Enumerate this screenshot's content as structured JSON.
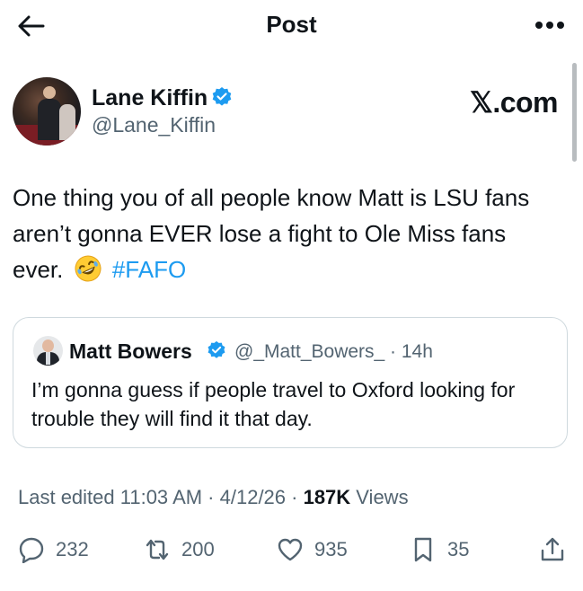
{
  "header": {
    "title": "Post",
    "back_icon": "arrow-left-icon",
    "more_icon": "more-horizontal-icon"
  },
  "author": {
    "name": "Lane Kiffin",
    "handle": "@Lane_Kiffin",
    "verified": true,
    "badge_color": "#1d9bf0"
  },
  "watermark": {
    "text": "𝕏.com"
  },
  "tweet": {
    "text_main": "One thing you of all people know Matt is LSU fans aren’t gonna EVER lose a fight to Ole Miss fans ever.",
    "emoji": "rolling-on-floor-laughing",
    "hashtag": "#FAFO",
    "hashtag_color": "#1d9bf0"
  },
  "quoted": {
    "name": "Matt Bowers",
    "handle_time": "@_Matt_Bowers_ · 14h",
    "verified": true,
    "text": "I’m gonna guess if people travel to Oxford  looking for trouble they will find it that day."
  },
  "meta": {
    "edited": "Last edited 11:03 AM · 4/12/26 · ",
    "views_count": "187K",
    "views_label": " Views"
  },
  "actions": {
    "replies": "232",
    "reposts": "200",
    "likes": "935",
    "bookmarks": "35"
  },
  "colors": {
    "text": "#0f1419",
    "secondary": "#536471",
    "border": "#cfd9de"
  }
}
